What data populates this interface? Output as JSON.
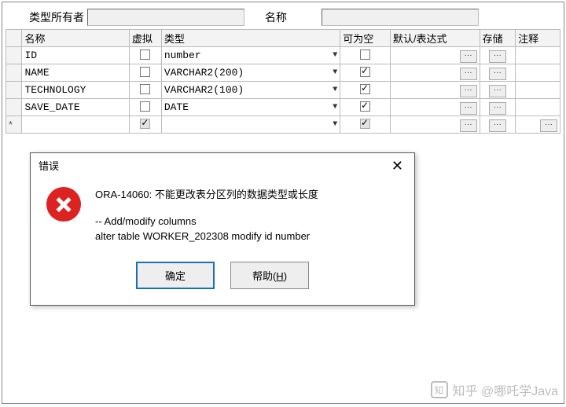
{
  "form": {
    "owner_label": "类型所有者",
    "owner_value": "",
    "name_label": "名称",
    "name_value": ""
  },
  "grid": {
    "headers": {
      "name": "名称",
      "virtual": "虚拟",
      "type": "类型",
      "nullable": "可为空",
      "default": "默认/表达式",
      "storage": "存储",
      "comment": "注释"
    },
    "rows": [
      {
        "marker": "",
        "name": "ID",
        "virtual": false,
        "virtual_disabled": false,
        "type": "number",
        "nullable": false,
        "nullable_disabled": false,
        "def_btn": true,
        "store_btn": true,
        "comm_btn": false
      },
      {
        "marker": "",
        "name": "NAME",
        "virtual": false,
        "virtual_disabled": false,
        "type": "VARCHAR2(200)",
        "nullable": true,
        "nullable_disabled": false,
        "def_btn": true,
        "store_btn": true,
        "comm_btn": false
      },
      {
        "marker": "",
        "name": "TECHNOLOGY",
        "virtual": false,
        "virtual_disabled": false,
        "type": "VARCHAR2(100)",
        "nullable": true,
        "nullable_disabled": false,
        "def_btn": true,
        "store_btn": true,
        "comm_btn": false
      },
      {
        "marker": "",
        "name": "SAVE_DATE",
        "virtual": false,
        "virtual_disabled": false,
        "type": "DATE",
        "nullable": true,
        "nullable_disabled": false,
        "def_btn": true,
        "store_btn": true,
        "comm_btn": false
      },
      {
        "marker": "*",
        "name": "",
        "virtual": true,
        "virtual_disabled": true,
        "type": "",
        "nullable": true,
        "nullable_disabled": true,
        "def_btn": true,
        "store_btn": true,
        "comm_btn": true
      }
    ]
  },
  "dialog": {
    "title": "错误",
    "message_main": "ORA-14060: 不能更改表分区列的数据类型或长度",
    "message_sub1": "-- Add/modify columns",
    "message_sub2": "alter table WORKER_202308 modify id number",
    "ok": "确定",
    "help_prefix": "帮助(",
    "help_key": "H",
    "help_suffix": ")"
  },
  "watermark": {
    "glyph": "知",
    "text": "知乎 @哪吒学Java"
  }
}
